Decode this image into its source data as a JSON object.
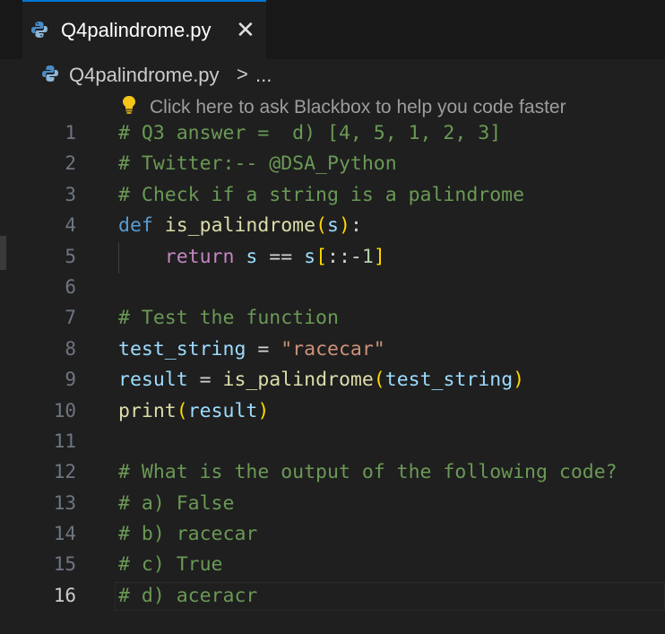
{
  "tab": {
    "filename": "Q4palindrome.py",
    "close_glyph": "✕"
  },
  "breadcrumb": {
    "file": "Q4palindrome.py",
    "separator": ">",
    "more": "..."
  },
  "hint": {
    "text": "Click here to ask Blackbox to help you code faster",
    "icon": "lightbulb-icon"
  },
  "editor": {
    "active_line": 16,
    "lines": [
      {
        "n": "1",
        "parts": [
          {
            "t": "# Q3 answer =  d) [4, 5, 1, 2, 3]",
            "c": "comment"
          }
        ]
      },
      {
        "n": "2",
        "parts": [
          {
            "t": "# Twitter:-- @DSA_Python",
            "c": "comment"
          }
        ]
      },
      {
        "n": "3",
        "parts": [
          {
            "t": "# Check if a string is a palindrome",
            "c": "comment"
          }
        ]
      },
      {
        "n": "4",
        "parts": [
          {
            "t": "def",
            "c": "kw"
          },
          {
            "t": " ",
            "c": "op"
          },
          {
            "t": "is_palindrome",
            "c": "fn"
          },
          {
            "t": "(",
            "c": "br1"
          },
          {
            "t": "s",
            "c": "var"
          },
          {
            "t": ")",
            "c": "br1"
          },
          {
            "t": ":",
            "c": "op"
          }
        ]
      },
      {
        "n": "5",
        "parts": [
          {
            "t": "    ",
            "c": "op"
          },
          {
            "t": "return",
            "c": "ctl"
          },
          {
            "t": " ",
            "c": "op"
          },
          {
            "t": "s",
            "c": "var"
          },
          {
            "t": " == ",
            "c": "op"
          },
          {
            "t": "s",
            "c": "var"
          },
          {
            "t": "[",
            "c": "br1"
          },
          {
            "t": "::-",
            "c": "op"
          },
          {
            "t": "1",
            "c": "num"
          },
          {
            "t": "]",
            "c": "br1"
          }
        ]
      },
      {
        "n": "6",
        "parts": []
      },
      {
        "n": "7",
        "parts": [
          {
            "t": "# Test the function",
            "c": "comment"
          }
        ]
      },
      {
        "n": "8",
        "parts": [
          {
            "t": "test_string",
            "c": "var"
          },
          {
            "t": " = ",
            "c": "op"
          },
          {
            "t": "\"racecar\"",
            "c": "str"
          }
        ]
      },
      {
        "n": "9",
        "parts": [
          {
            "t": "result",
            "c": "var"
          },
          {
            "t": " = ",
            "c": "op"
          },
          {
            "t": "is_palindrome",
            "c": "fn"
          },
          {
            "t": "(",
            "c": "br1"
          },
          {
            "t": "test_string",
            "c": "var"
          },
          {
            "t": ")",
            "c": "br1"
          }
        ]
      },
      {
        "n": "10",
        "parts": [
          {
            "t": "print",
            "c": "fn"
          },
          {
            "t": "(",
            "c": "br1"
          },
          {
            "t": "result",
            "c": "var"
          },
          {
            "t": ")",
            "c": "br1"
          }
        ]
      },
      {
        "n": "11",
        "parts": []
      },
      {
        "n": "12",
        "parts": [
          {
            "t": "# What is the output of the following code?",
            "c": "comment"
          }
        ]
      },
      {
        "n": "13",
        "parts": [
          {
            "t": "# a) False",
            "c": "comment"
          }
        ]
      },
      {
        "n": "14",
        "parts": [
          {
            "t": "# b) racecar",
            "c": "comment"
          }
        ]
      },
      {
        "n": "15",
        "parts": [
          {
            "t": "# c) True",
            "c": "comment"
          }
        ]
      },
      {
        "n": "16",
        "parts": [
          {
            "t": "# d) aceracr",
            "c": "comment"
          }
        ]
      }
    ]
  },
  "colors": {
    "background": "#1f1f1f",
    "tab_accent": "#0078d4",
    "comment": "#6a9955",
    "keyword": "#569cd6",
    "function": "#dcdcaa",
    "variable": "#9cdcfe",
    "string": "#ce9178"
  }
}
